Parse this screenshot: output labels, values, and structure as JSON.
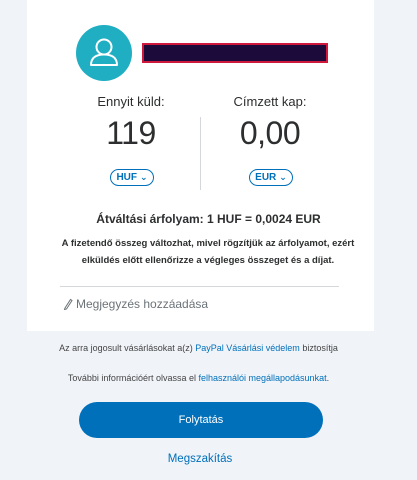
{
  "recipient": {
    "name_redacted": true
  },
  "send": {
    "label": "Ennyit küld:",
    "amount": "119",
    "currency": "HUF"
  },
  "receive": {
    "label": "Címzett kap:",
    "amount": "0,00",
    "currency": "EUR"
  },
  "exchange": {
    "rate_text": "Átváltási árfolyam: 1 HUF = 0,0024 EUR",
    "note_line1": "A fizetendő összeg változhat, mivel rögzítjük az árfolyamot, ezért",
    "note_line2": "elküldés előtt ellenőrizze a végleges összeget és a díjat."
  },
  "add_note": {
    "label": "Megjegyzés hozzáadása"
  },
  "footer": {
    "protection_prefix": "Az arra jogosult vásárlásokat a(z)",
    "protection_link": "PayPal Vásárlási védelem",
    "protection_suffix": "biztosítja",
    "info_prefix": "További információért olvassa el",
    "info_link": "felhasználói megállapodásunkat",
    "info_suffix": "."
  },
  "actions": {
    "continue_label": "Folytatás",
    "cancel_label": "Megszakítás"
  },
  "colors": {
    "accent": "#0070ba",
    "avatar": "#1faec2",
    "background": "#f0f3f8"
  }
}
